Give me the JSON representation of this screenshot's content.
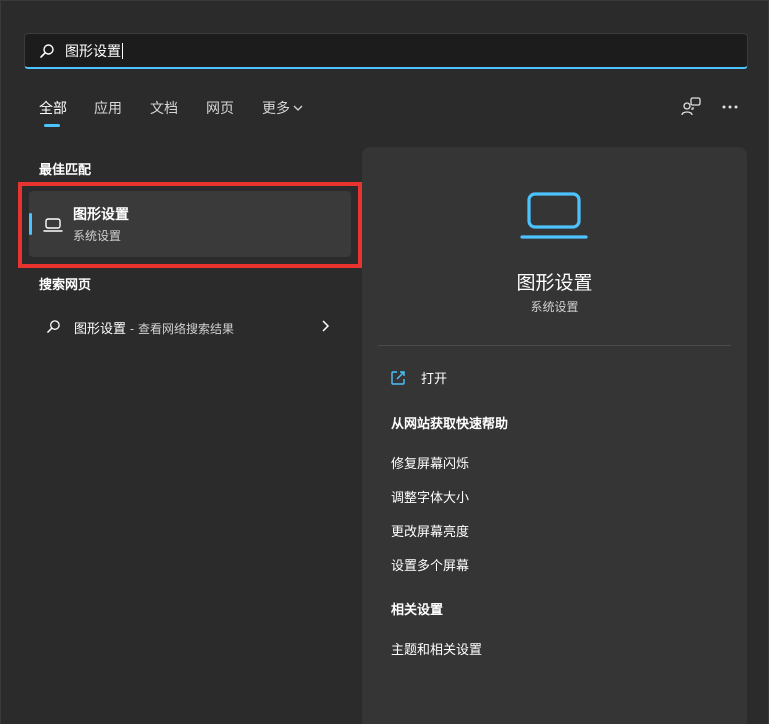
{
  "colors": {
    "accent": "#4cc2ff",
    "highlight": "#e8332f",
    "panel": "#2b2b2b",
    "detail": "#353535"
  },
  "search": {
    "query": "图形设置",
    "icon": "search-icon"
  },
  "tabs": [
    {
      "label": "全部",
      "active": true
    },
    {
      "label": "应用"
    },
    {
      "label": "文档"
    },
    {
      "label": "网页"
    },
    {
      "label": "更多"
    }
  ],
  "toolbar": {
    "account_icon": "account-switch-icon",
    "more_icon": "more-options-icon"
  },
  "best_match": {
    "heading": "最佳匹配",
    "title": "图形设置",
    "subtitle": "系统设置",
    "icon": "laptop-icon"
  },
  "web_search": {
    "heading": "搜索网页",
    "query": "图形设置",
    "suffix": " - 查看网络搜索结果",
    "icon": "search-icon",
    "arrow_icon": "chevron-right-icon"
  },
  "detail": {
    "title": "图形设置",
    "subtitle": "系统设置",
    "open_label": "打开",
    "help_heading": "从网站获取快速帮助",
    "help_links": [
      "修复屏幕闪烁",
      "调整字体大小",
      "更改屏幕亮度",
      "设置多个屏幕"
    ],
    "related_heading": "相关设置",
    "related_links": [
      "主题和相关设置"
    ]
  }
}
